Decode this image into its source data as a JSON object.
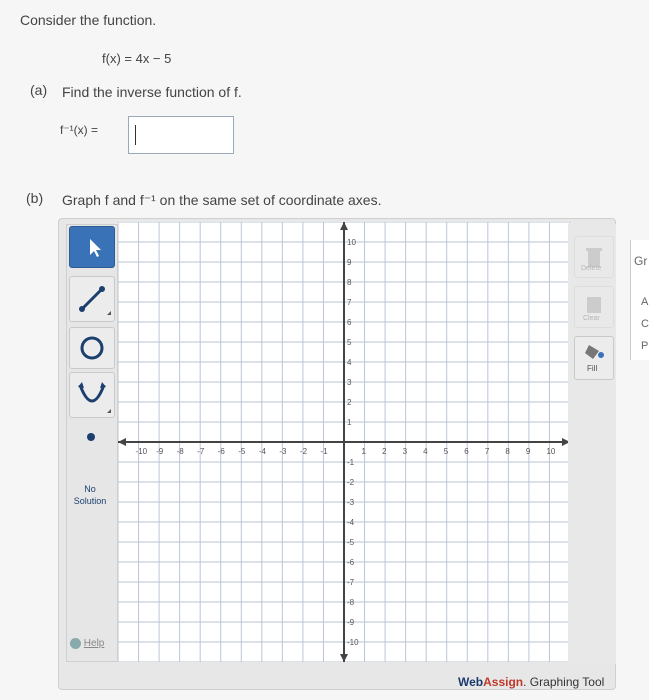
{
  "prompt": "Consider the function.",
  "function": "f(x) = 4x − 5",
  "part_a": {
    "tag": "(a)",
    "text": "Find the inverse function of f.",
    "answer_label": "f⁻¹(x) =",
    "answer_value": ""
  },
  "part_b": {
    "tag": "(b)",
    "text": "Graph f and f⁻¹ on the same set of coordinate axes."
  },
  "tools": {
    "no_solution_label": "No Solution",
    "help_label": "Help",
    "fill_label": "Fill",
    "delete_label": "Delete",
    "clear_label": "Clear"
  },
  "graph": {
    "x_ticks": [
      "-10",
      "-9",
      "-8",
      "-7",
      "-6",
      "-5",
      "-4",
      "-3",
      "-2",
      "-1",
      "1",
      "2",
      "3",
      "4",
      "5",
      "6",
      "7",
      "8",
      "9",
      "10"
    ],
    "y_ticks": [
      "10",
      "9",
      "8",
      "7",
      "6",
      "5",
      "4",
      "3",
      "2",
      "1",
      "-1",
      "-2",
      "-3",
      "-4",
      "-5",
      "-6",
      "-7",
      "-8",
      "-9",
      "-10"
    ]
  },
  "footer": {
    "brand_web": "Web",
    "brand_assign": "Assign",
    "brand_suffix": ". Graphing Tool"
  },
  "side_panel": {
    "items": [
      "Gr",
      "A",
      "C",
      "P"
    ]
  }
}
